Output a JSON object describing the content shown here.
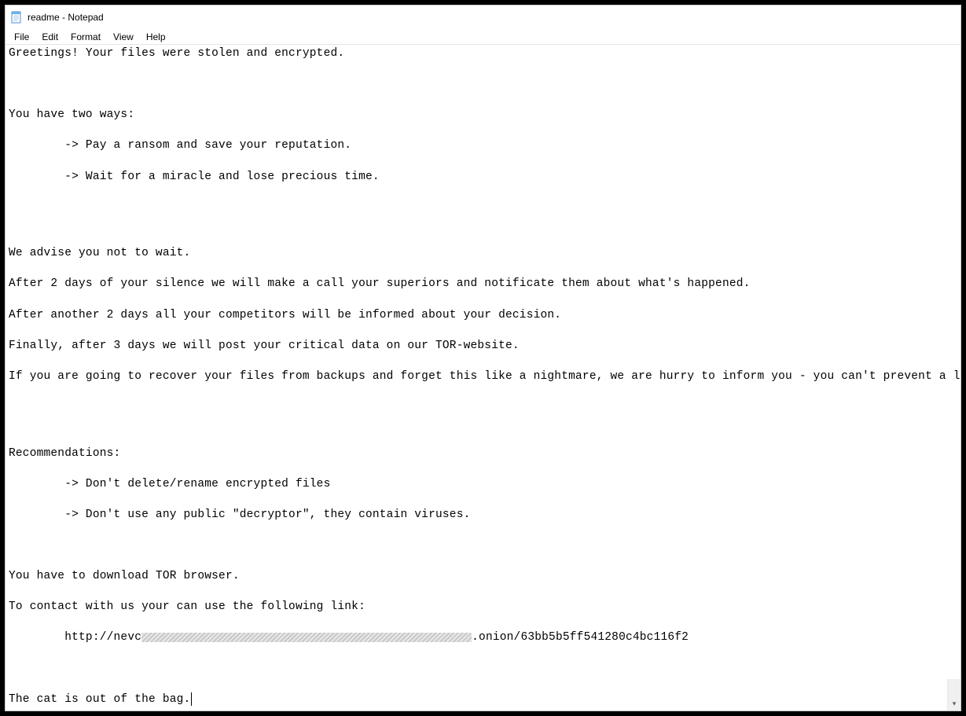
{
  "window": {
    "title": "readme - Notepad"
  },
  "menu": {
    "file": "File",
    "edit": "Edit",
    "format": "Format",
    "view": "View",
    "help": "Help"
  },
  "content": {
    "line1": "Greetings! Your files were stolen and encrypted.",
    "line2": "You have two ways:",
    "opt1": "        -> Pay a ransom and save your reputation.",
    "opt2": "        -> Wait for a miracle and lose precious time.",
    "advise1": "We advise you not to wait.",
    "advise2": "After 2 days of your silence we will make a call your superiors and notificate them about what's happened.",
    "advise3": "After another 2 days all your competitors will be informed about your decision.",
    "advise4": "Finally, after 3 days we will post your critical data on our TOR-website.",
    "advise5": "If you are going to recover your files from backups and forget this like a nightmare, we are hurry to inform you - you can't prevent a leak.",
    "rec_header": "Recommendations:",
    "rec1": "        -> Don't delete/rename encrypted files",
    "rec2": "        -> Don't use any public \"decryptor\", they contain viruses.",
    "tor1": "You have to download TOR browser.",
    "tor2": "To contact with us your can use the following link:",
    "url_prefix": "        http://nevc",
    "url_suffix": ".onion/63bb5b5ff541280c4bc116f2",
    "closing": "The cat is out of the bag."
  }
}
